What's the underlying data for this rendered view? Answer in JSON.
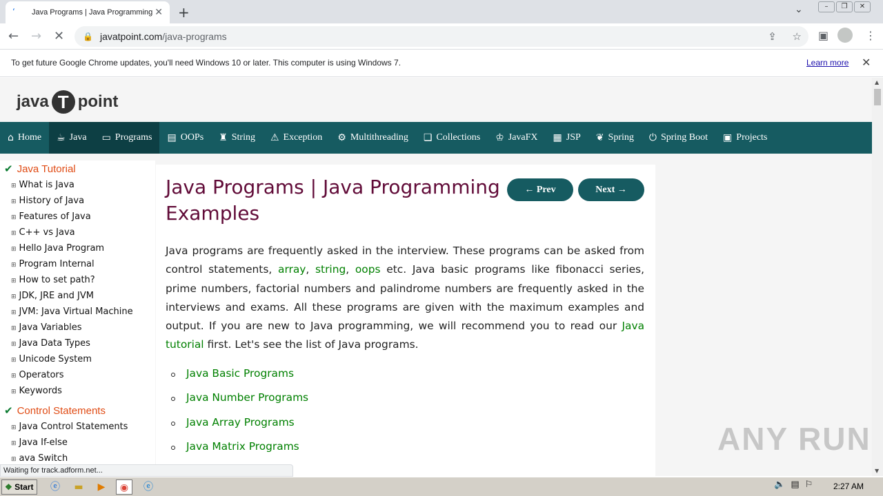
{
  "browser": {
    "tab_title": "Java Programs | Java Programming E",
    "url_domain": "javatpoint.com",
    "url_path": "/java-programs",
    "infobar_message": "To get future Google Chrome updates, you'll need Windows 10 or later. This computer is using Windows 7.",
    "infobar_link": "Learn more",
    "status_text": "Waiting for track.adform.net..."
  },
  "site": {
    "logo_left": "java",
    "logo_t": "T",
    "logo_right": "point",
    "nav": [
      {
        "label": "Home",
        "icon": "home-icon"
      },
      {
        "label": "Java",
        "icon": "java-cup-icon"
      },
      {
        "label": "Programs",
        "icon": "monitor-icon"
      },
      {
        "label": "OOPs",
        "icon": "oops-icon"
      },
      {
        "label": "String",
        "icon": "string-icon"
      },
      {
        "label": "Exception",
        "icon": "warning-icon"
      },
      {
        "label": "Multithreading",
        "icon": "thread-icon"
      },
      {
        "label": "Collections",
        "icon": "collections-icon"
      },
      {
        "label": "JavaFX",
        "icon": "javafx-icon"
      },
      {
        "label": "JSP",
        "icon": "jsp-icon"
      },
      {
        "label": "Spring",
        "icon": "spring-icon"
      },
      {
        "label": "Spring Boot",
        "icon": "power-icon"
      },
      {
        "label": "Projects",
        "icon": "projects-icon"
      }
    ]
  },
  "sidebar": {
    "heading1": "Java Tutorial",
    "items1": [
      "What is Java",
      "History of Java",
      "Features of Java",
      "C++ vs Java",
      "Hello Java Program",
      "Program Internal",
      "How to set path?",
      "JDK, JRE and JVM",
      "JVM: Java Virtual Machine",
      "Java Variables",
      "Java Data Types",
      "Unicode System",
      "Operators",
      "Keywords"
    ],
    "heading2": "Control Statements",
    "items2": [
      "Java Control Statements",
      "Java If-else",
      "ava Switch"
    ]
  },
  "main": {
    "title": "Java Programs | Java Programming Examples",
    "prev_label": "← Prev",
    "next_label": "Next →",
    "intro_1": "Java programs are frequently asked in the interview. These programs can be asked from control statements, ",
    "link_array": "array",
    "sep_1": ", ",
    "link_string": "string",
    "sep_2": ", ",
    "link_oops": "oops",
    "intro_2": " etc. Java basic programs like fibonacci series, prime numbers, factorial numbers and palindrome numbers are frequently asked in the interviews and exams. All these programs are given with the maximum examples and output. If you are new to Java programming, we will recommend you to read our ",
    "link_tutorial": "Java tutorial",
    "intro_3": " first. Let's see the list of Java programs.",
    "programs": [
      "Java Basic Programs",
      "Java Number Programs",
      "Java Array Programs",
      "Java Matrix Programs"
    ]
  },
  "watermark": "ANY RUN",
  "taskbar": {
    "start_label": "Start",
    "clock": "2:27 AM"
  },
  "colors": {
    "nav_bg": "#165b61",
    "title": "#610b38",
    "link": "#008000",
    "sidebar_heading": "#e04b14"
  }
}
